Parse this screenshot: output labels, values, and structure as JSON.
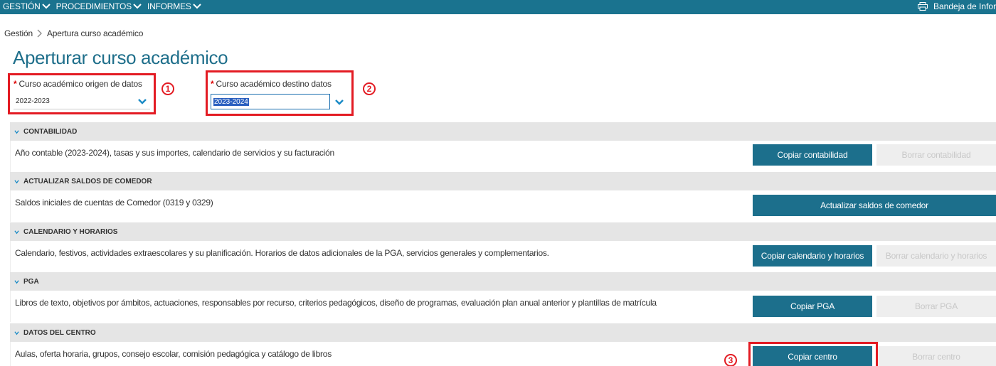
{
  "nav": {
    "menu": [
      "GESTIÓN",
      "PROCEDIMIENTOS",
      "INFORMES"
    ],
    "inbox_label": "Bandeja de Informe",
    "print_icon": "printer-icon"
  },
  "breadcrumb": {
    "root": "Gestión",
    "current": "Apertura curso académico"
  },
  "page": {
    "title": "Aperturar curso académico"
  },
  "origin": {
    "label": "Curso académico origen de datos",
    "value": "2022-2023",
    "required": "*",
    "step": "1"
  },
  "destination": {
    "label": "Curso académico destino datos",
    "value": "2023-2024",
    "required": "*",
    "step": "2"
  },
  "step3": "3",
  "sections": [
    {
      "title": "CONTABILIDAD",
      "description": "Año contable (2023-2024), tasas y sus importes, calendario de servicios y su facturación",
      "primary_button": "Copiar contabilidad",
      "secondary_button": "Borrar contabilidad"
    },
    {
      "title": "ACTUALIZAR SALDOS DE COMEDOR",
      "description": "Saldos iniciales de cuentas de Comedor (0319 y 0329)",
      "primary_button": "Actualizar saldos de comedor"
    },
    {
      "title": "CALENDARIO Y HORARIOS",
      "description": "Calendario, festivos, actividades extraescolares y su planificación. Horarios de datos adicionales de la PGA, servicios generales y complementarios.",
      "primary_button": "Copiar calendario y horarios",
      "secondary_button": "Borrar calendario y horarios"
    },
    {
      "title": "PGA",
      "description": "Libros de texto, objetivos por ámbitos, actuaciones, responsables por recurso, criterios pedagógicos, diseño de programas, evaluación plan anual anterior y plantillas de matrícula",
      "primary_button": "Copiar PGA",
      "secondary_button": "Borrar PGA"
    },
    {
      "title": "DATOS DEL CENTRO",
      "description": "Aulas, oferta horaria, grupos, consejo escolar, comisión pedagógica y catálogo de libros",
      "primary_button": "Copiar centro",
      "secondary_button": "Borrar centro"
    }
  ],
  "colors": {
    "topbar": "#1a738f",
    "primary": "#1c6f8c",
    "highlight": "#e31b23",
    "title": "#1f6f8b"
  }
}
